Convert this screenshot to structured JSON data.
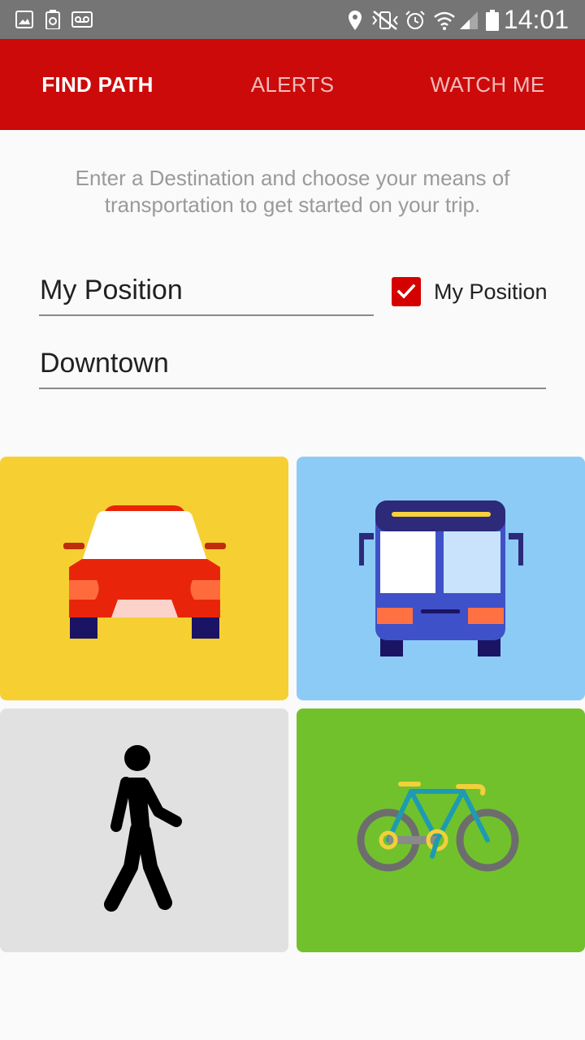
{
  "status_bar": {
    "time": "14:01"
  },
  "tabs": [
    {
      "label": "FIND PATH",
      "active": true
    },
    {
      "label": "ALERTS",
      "active": false
    },
    {
      "label": "WATCH ME",
      "active": false
    }
  ],
  "intro_text": "Enter a Destination and choose your means of transportation to get started on your trip.",
  "origin": {
    "value": "My Position",
    "checkbox_label": "My Position",
    "checked": true
  },
  "destination": {
    "value": "Downtown"
  },
  "transport_modes": [
    {
      "name": "car",
      "icon": "car-icon",
      "color": "#f6d033"
    },
    {
      "name": "bus",
      "icon": "bus-icon",
      "color": "#8dcbf7"
    },
    {
      "name": "walk",
      "icon": "pedestrian-icon",
      "color": "#e1e1e1"
    },
    {
      "name": "bike",
      "icon": "bicycle-icon",
      "color": "#71c12d"
    }
  ],
  "colors": {
    "app_bar": "#cc0a0a",
    "accent": "#d50000"
  }
}
